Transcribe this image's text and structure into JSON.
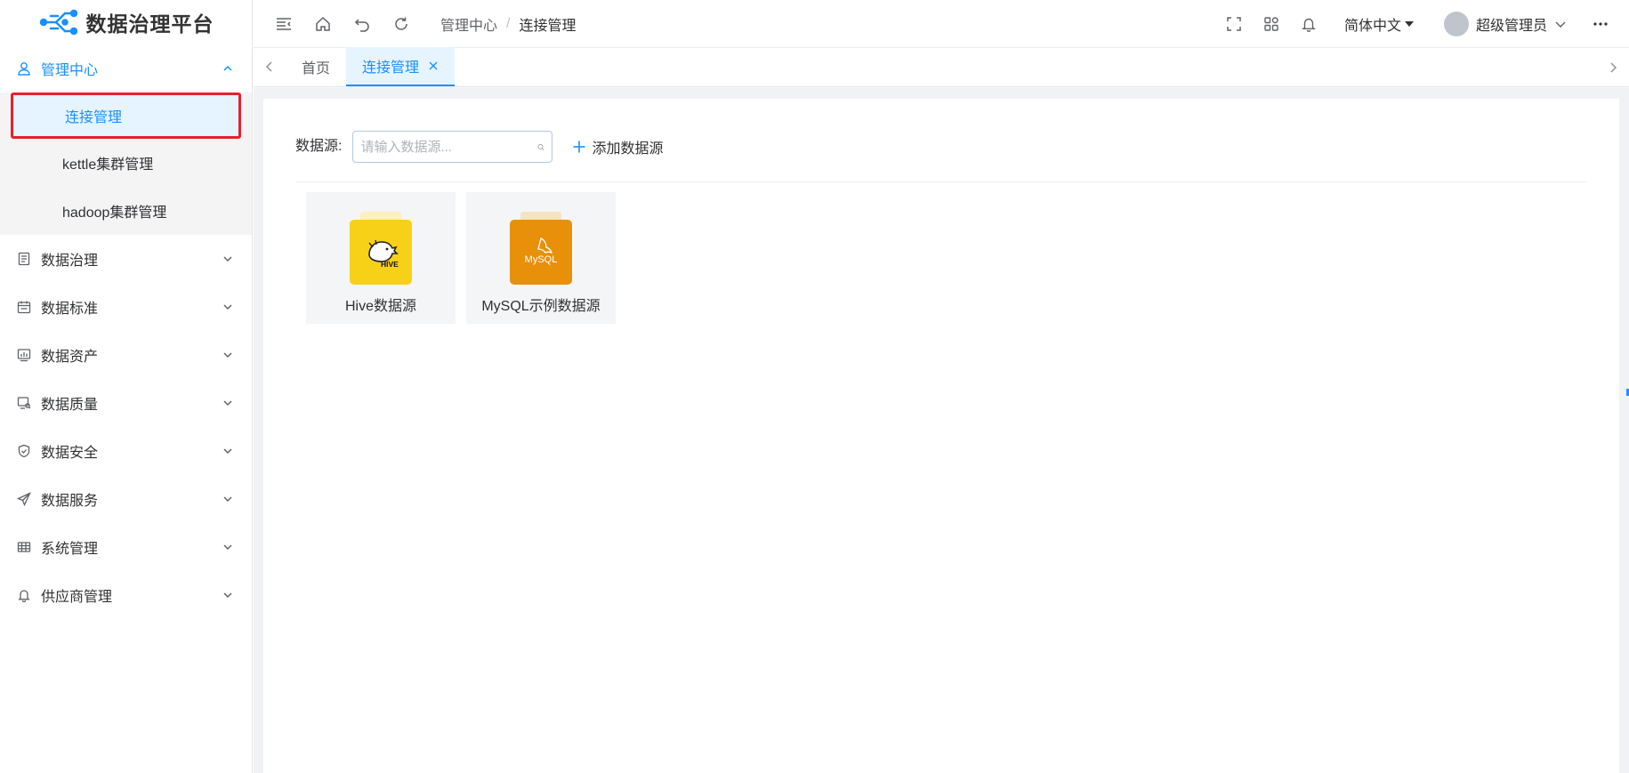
{
  "app": {
    "title": "数据治理平台"
  },
  "sidebar": {
    "groups": [
      {
        "label": "管理中心",
        "icon": "user-icon",
        "expanded": true,
        "items": [
          {
            "label": "连接管理",
            "selected": true
          },
          {
            "label": "kettle集群管理"
          },
          {
            "label": "hadoop集群管理"
          }
        ]
      },
      {
        "label": "数据治理",
        "icon": "document-icon"
      },
      {
        "label": "数据标准",
        "icon": "calendar-icon"
      },
      {
        "label": "数据资产",
        "icon": "chart-monitor-icon"
      },
      {
        "label": "数据质量",
        "icon": "monitor-search-icon"
      },
      {
        "label": "数据安全",
        "icon": "shield-check-icon"
      },
      {
        "label": "数据服务",
        "icon": "send-icon"
      },
      {
        "label": "系统管理",
        "icon": "table-icon"
      },
      {
        "label": "供应商管理",
        "icon": "bell-icon"
      }
    ]
  },
  "header": {
    "breadcrumb": [
      "管理中心",
      "连接管理"
    ],
    "breadcrumb_sep": "/",
    "language": "简体中文",
    "user": "超级管理员"
  },
  "tabs": [
    {
      "label": "首页",
      "active": false
    },
    {
      "label": "连接管理",
      "active": true,
      "closable": true
    }
  ],
  "main": {
    "filter_label": "数据源:",
    "search_placeholder": "请输入数据源...",
    "add_label": "添加数据源",
    "datasources": [
      {
        "label": "Hive数据源",
        "logo": "HIVE",
        "color": "#f7d117",
        "back_color": "#fbf0c0"
      },
      {
        "label": "MySQL示例数据源",
        "logo": "MySQL",
        "color": "#e8900a",
        "back_color": "#f5e3c4"
      }
    ]
  },
  "colors": {
    "accent": "#1890ff",
    "highlight_border": "#e8202a"
  }
}
